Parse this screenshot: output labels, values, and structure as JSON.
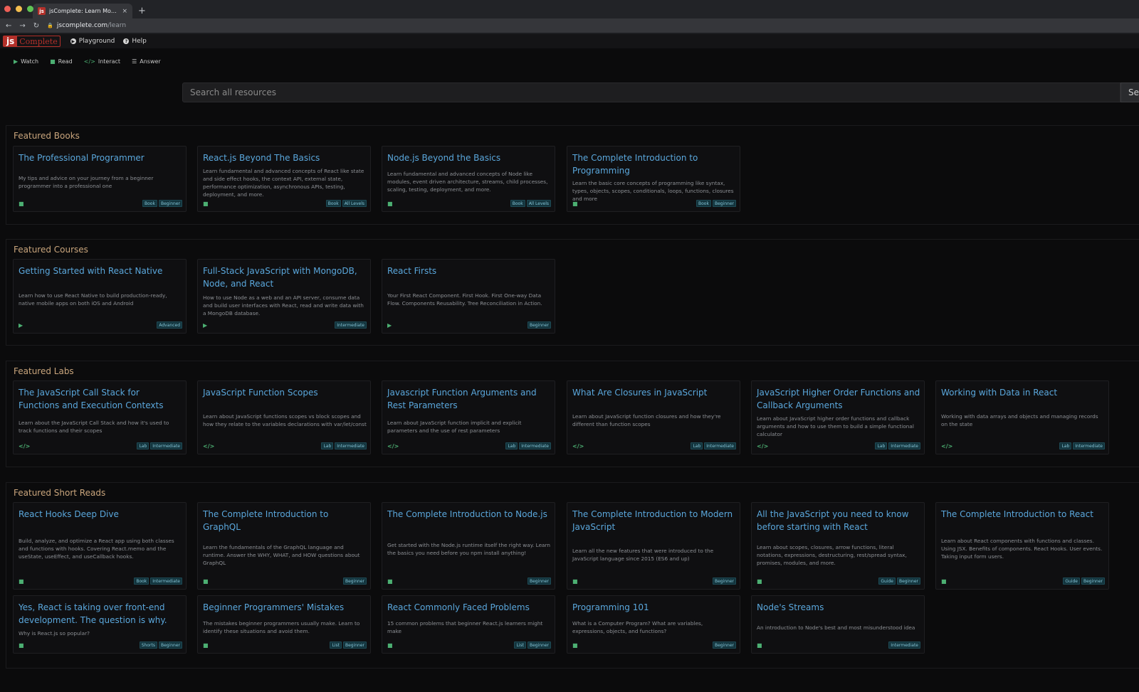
{
  "browser": {
    "tab_title": "jsComplete: Learn Modern Full",
    "tab_favicon": "js",
    "tab_close": "×",
    "new_tab": "+",
    "url_host": "jscomplete.com",
    "url_path": "/learn"
  },
  "header": {
    "logo_js": "js",
    "logo_rest": "Complete",
    "nav": [
      {
        "label": "Playground",
        "icon": "play-circle-icon"
      },
      {
        "label": "Help",
        "icon": "question-circle-icon"
      }
    ]
  },
  "filters": [
    {
      "label": "Watch",
      "icon": "play-icon"
    },
    {
      "label": "Read",
      "icon": "book-icon"
    },
    {
      "label": "Interact",
      "icon": "code-icon"
    },
    {
      "label": "Answer",
      "icon": "list-icon"
    }
  ],
  "search": {
    "placeholder": "Search all resources",
    "button_label": "Search"
  },
  "sections": [
    {
      "title": "Featured Books",
      "cards": [
        {
          "title": "The Professional Programmer",
          "desc": "My tips and advice on your journey from a beginner programmer into a professional one",
          "icon": "book-icon",
          "badges": [
            "Book",
            "Beginner"
          ]
        },
        {
          "title": "React.js Beyond The Basics",
          "desc": "Learn fundamental and advanced concepts of React like state and side effect hooks, the context API, external state, performance optimization, asynchronous APIs, testing, deployment, and more.",
          "icon": "book-icon",
          "badges": [
            "Book",
            "All Levels"
          ]
        },
        {
          "title": "Node.js Beyond the Basics",
          "desc": "Learn fundamental and advanced concepts of Node like modules, event driven architecture, streams, child processes, scaling, testing, deployment, and more.",
          "icon": "book-icon",
          "badges": [
            "Book",
            "All Levels"
          ]
        },
        {
          "title": "The Complete Introduction to Programming",
          "desc": "Learn the basic core concepts of programming like syntax, types, objects, scopes, conditionals, loops, functions, closures and more",
          "icon": "book-icon",
          "badges": [
            "Book",
            "Beginner"
          ]
        }
      ]
    },
    {
      "title": "Featured Courses",
      "cards": [
        {
          "title": "Getting Started with React Native",
          "desc": "Learn how to use React Native to build production-ready, native mobile apps on both iOS and Android",
          "icon": "play-icon",
          "badges": [
            "Advanced"
          ]
        },
        {
          "title": "Full-Stack JavaScript with MongoDB, Node, and React",
          "desc": "How to use Node as a web and an API server, consume data and build user interfaces with React, read and write data with a MongoDB database.",
          "icon": "play-icon",
          "badges": [
            "Intermediate"
          ]
        },
        {
          "title": "React Firsts",
          "desc": "Your First React Component. First Hook. First One-way Data Flow. Components Reusability. Tree Reconciliation in Action.",
          "icon": "play-icon",
          "badges": [
            "Beginner"
          ]
        }
      ]
    },
    {
      "title": "Featured Labs",
      "cards": [
        {
          "title": "The JavaScript Call Stack for Functions and Execution Contexts",
          "desc": "Learn about the JavaScript Call Stack and how it's used to track functions and their scopes",
          "icon": "code-icon",
          "badges": [
            "Lab",
            "Intermediate"
          ]
        },
        {
          "title": "JavaScript Function Scopes",
          "desc": "Learn about JavaScript functions scopes vs block scopes and how they relate to the variables declarations with var/let/const",
          "icon": "code-icon",
          "badges": [
            "Lab",
            "Intermediate"
          ]
        },
        {
          "title": "Javascript Function Arguments and Rest Parameters",
          "desc": "Learn about JavaScript function implicit and explicit parameters and the use of rest parameters",
          "icon": "code-icon",
          "badges": [
            "Lab",
            "Intermediate"
          ]
        },
        {
          "title": "What Are Closures in JavaScript",
          "desc": "Learn about JavaScript function closures and how they're different than function scopes",
          "icon": "code-icon",
          "badges": [
            "Lab",
            "Intermediate"
          ]
        },
        {
          "title": "JavaScript Higher Order Functions and Callback Arguments",
          "desc": "Learn about JavaScript higher order functions and callback arguments and how to use them to build a simple functional calculator",
          "icon": "code-icon",
          "badges": [
            "Lab",
            "Intermediate"
          ]
        },
        {
          "title": "Working with Data in React",
          "desc": "Working with data arrays and objects and managing records on the state",
          "icon": "code-icon",
          "badges": [
            "Lab",
            "Intermediate"
          ]
        }
      ]
    },
    {
      "title": "Featured Short Reads",
      "cards": [
        {
          "title": "React Hooks Deep Dive",
          "desc": "Build, analyze, and optimize a React app using both classes and functions with hooks. Covering React.memo and the useState, useEffect, and useCallback hooks.",
          "icon": "book-icon",
          "badges": [
            "Book",
            "Intermediate"
          ]
        },
        {
          "title": "The Complete Introduction to GraphQL",
          "desc": "Learn the fundamentals of the GraphQL language and runtime. Answer the WHY, WHAT, and HOW questions about GraphQL",
          "icon": "book-icon",
          "badges": [
            "Beginner"
          ]
        },
        {
          "title": "The Complete Introduction to Node.js",
          "desc": "Get started with the Node.js runtime itself the right way. Learn the basics you need before you npm install anything!",
          "icon": "book-icon",
          "badges": [
            "Beginner"
          ]
        },
        {
          "title": "The Complete Introduction to Modern JavaScript",
          "desc": "Learn all the new features that were introduced to the JavaScript language since 2015 (ES6 and up)",
          "icon": "book-icon",
          "badges": [
            "Beginner"
          ]
        },
        {
          "title": "All the JavaScript you need to know before starting with React",
          "desc": "Learn about scopes, closures, arrow functions, literal notations, expressions, destructuring, rest/spread syntax, promises, modules, and more.",
          "icon": "book-icon",
          "badges": [
            "Guide",
            "Beginner"
          ]
        },
        {
          "title": "The Complete Introduction to React",
          "desc": "Learn about React components with functions and classes. Using JSX. Benefits of components. React Hooks. User events. Taking input form users.",
          "icon": "book-icon",
          "badges": [
            "Guide",
            "Beginner"
          ]
        },
        {
          "title": "Yes, React is taking over front-end development. The question is why.",
          "desc": "Why is React.js so popular?",
          "icon": "book-icon",
          "badges": [
            "Shorts",
            "Beginner"
          ]
        },
        {
          "title": "Beginner Programmers' Mistakes",
          "desc": "The mistakes beginner programmers usually make. Learn to identify these situations and avoid them.",
          "icon": "book-icon",
          "badges": [
            "List",
            "Beginner"
          ]
        },
        {
          "title": "React Commonly Faced Problems",
          "desc": "15 common problems that beginner React.js learners might make",
          "icon": "book-icon",
          "badges": [
            "List",
            "Beginner"
          ]
        },
        {
          "title": "Programming 101",
          "desc": "What is a Computer Program? What are variables, expressions, objects, and functions?",
          "icon": "book-icon",
          "badges": [
            "Beginner"
          ]
        },
        {
          "title": "Node's Streams",
          "desc": "An introduction to Node's best and most misunderstood idea",
          "icon": "book-icon",
          "badges": [
            "Intermediate"
          ]
        }
      ]
    }
  ]
}
